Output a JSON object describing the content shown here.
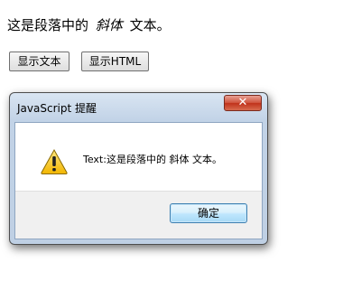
{
  "page": {
    "paragraph_prefix": "这是段落中的",
    "paragraph_italic": "斜体",
    "paragraph_suffix": "文本。",
    "buttons": {
      "show_text": "显示文本",
      "show_html": "显示HTML"
    }
  },
  "dialog": {
    "title": "JavaScript 提醒",
    "close_symbol": "✕",
    "icon": "warning-icon",
    "message": "Text:这是段落中的 斜体 文本。",
    "ok_label": "确定",
    "colors": {
      "close_button": "#c0321b",
      "ok_border": "#3c7fb1",
      "frame": "#bfd0e4"
    }
  }
}
